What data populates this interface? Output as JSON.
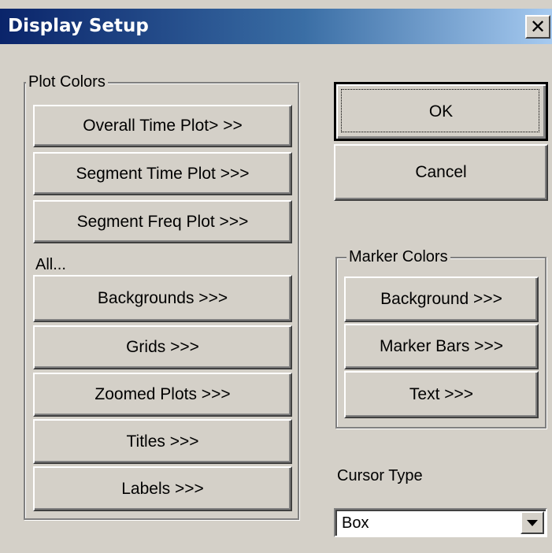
{
  "window": {
    "title": "Display Setup",
    "close_glyph": "✕"
  },
  "plot_colors": {
    "group_label": "Plot Colors",
    "buttons": [
      "Overall Time Plot> >>",
      "Segment Time Plot >>>",
      "Segment Freq Plot >>>"
    ],
    "all_label": "All...",
    "all_buttons": [
      "Backgrounds >>>",
      "Grids >>>",
      "Zoomed Plots >>>",
      "Titles >>>",
      "Labels >>>"
    ]
  },
  "actions": {
    "ok_label": "OK",
    "cancel_label": "Cancel"
  },
  "marker_colors": {
    "group_label": "Marker Colors",
    "buttons": [
      "Background >>>",
      "Marker Bars >>>",
      "Text >>>"
    ]
  },
  "cursor": {
    "label": "Cursor Type",
    "selected": "Box"
  },
  "icons": {
    "close": "close-icon",
    "dropdown": "chevron-down-icon"
  },
  "colors": {
    "titlebar_start": "#0a246a",
    "titlebar_end": "#a6caf0",
    "face": "#d4d0c8"
  }
}
